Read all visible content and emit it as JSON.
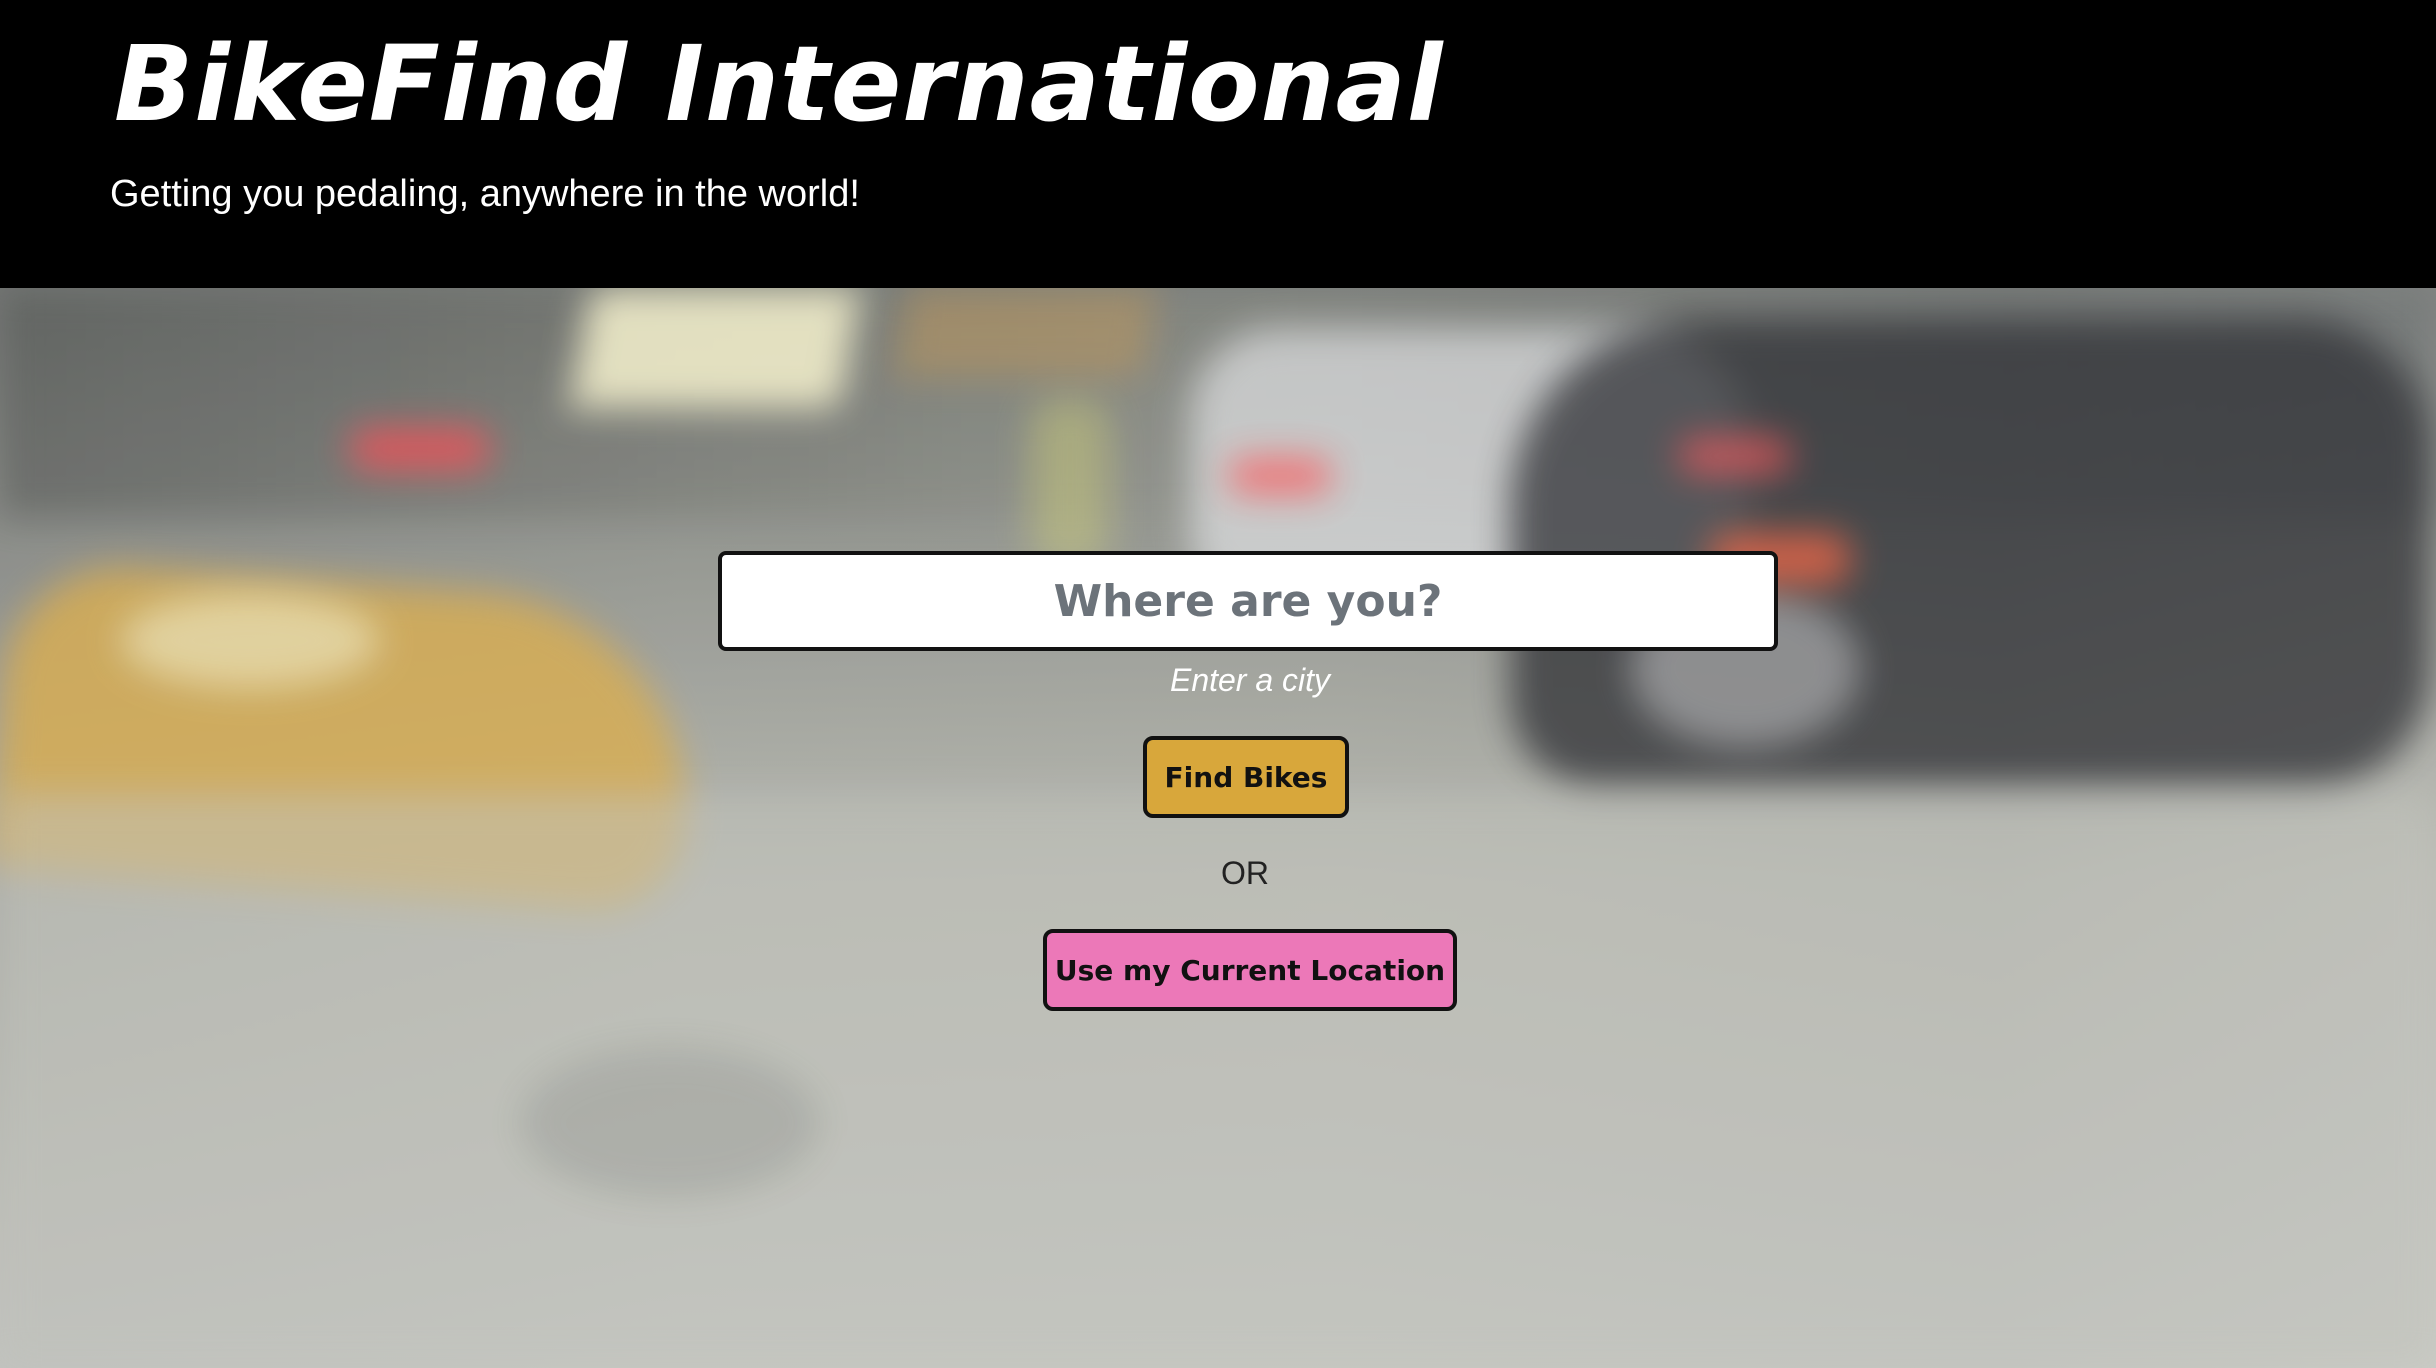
{
  "header": {
    "title": "BikeFind International",
    "subtitle": "Getting you pedaling, anywhere in the world!"
  },
  "search": {
    "placeholder": "Where are you?",
    "hint": "Enter a city",
    "find_label": "Find Bikes",
    "or_label": "OR",
    "current_location_label": "Use my Current Location"
  },
  "colors": {
    "header_background": "#000000",
    "header_text": "#ffffff",
    "find_button": "#d8a73b",
    "current_location_button": "#ec78b8",
    "button_border": "#111111",
    "placeholder_text": "#6c737a"
  },
  "background": {
    "description": "blurred street scene with moving vehicles"
  }
}
